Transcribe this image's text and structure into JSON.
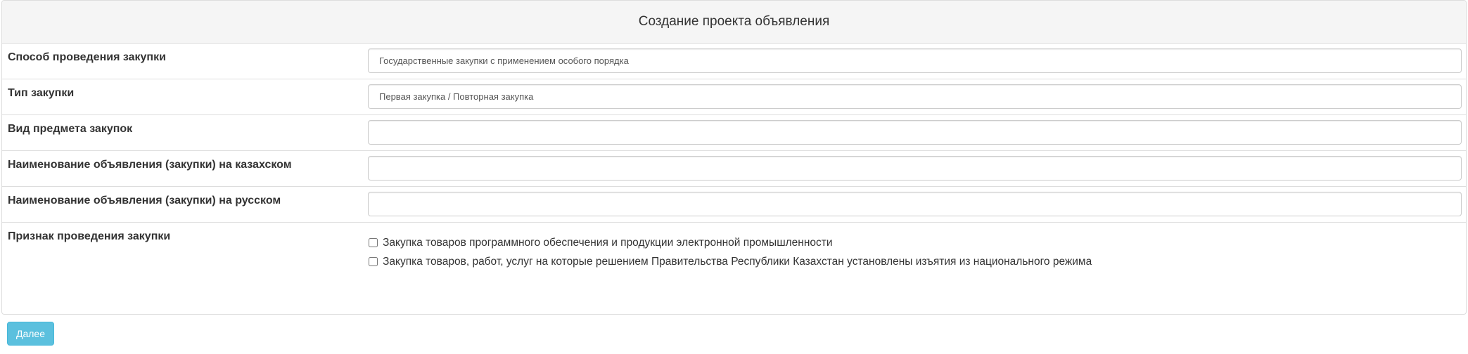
{
  "panel": {
    "title": "Создание проекта объявления"
  },
  "form": {
    "method": {
      "label": "Способ проведения закупки",
      "value": "Государственные закупки с применением особого порядка"
    },
    "type": {
      "label": "Тип закупки",
      "value": "Первая закупка / Повторная закупка"
    },
    "subject": {
      "label": "Вид предмета закупок",
      "value": ""
    },
    "name_kz": {
      "label": "Наименование объявления (закупки) на казахском",
      "value": ""
    },
    "name_ru": {
      "label": "Наименование объявления (закупки) на русском",
      "value": ""
    },
    "attribute": {
      "label": "Признак проведения закупки",
      "options": [
        {
          "label": "Закупка товаров программного обеспечения и продукции электронной промышленности",
          "checked": false
        },
        {
          "label": "Закупка товаров, работ, услуг на которые решением Правительства Республики Казахстан установлены изъятия из национального режима",
          "checked": false
        }
      ]
    }
  },
  "actions": {
    "next_label": "Далее"
  },
  "colors": {
    "next_button": "#5bc0de",
    "panel_heading_bg": "#f5f5f5",
    "border": "#dddddd"
  }
}
